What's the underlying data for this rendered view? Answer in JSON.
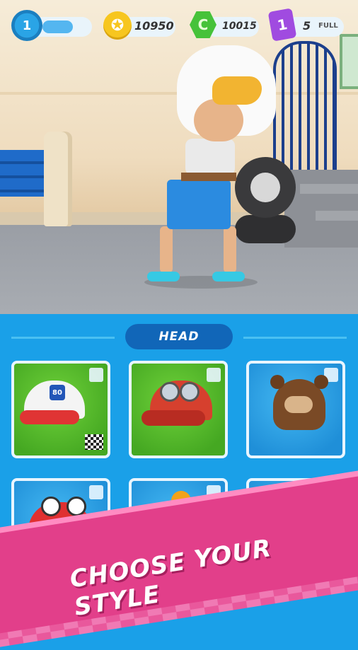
{
  "hud": {
    "level": "1",
    "coins": "10950",
    "coin_icon": "wheel-coin-icon",
    "gems": "10015",
    "gem_icon": "hexagon-gem-icon",
    "keys": "5",
    "key_icon": "key-card-icon",
    "key_card_symbol": "1",
    "key_status": "FULL",
    "xp_fill_fraction": 0.65
  },
  "wardrobe": {
    "category_tab": "HEAD",
    "items": [
      {
        "id": "cap-80",
        "bg": "green",
        "icon": "route-80-cap-icon",
        "badge": "80",
        "extra": "checkered-flag-icon"
      },
      {
        "id": "goggle-cap",
        "bg": "green",
        "icon": "goggles-cap-icon"
      },
      {
        "id": "bear-hat",
        "bg": "blue",
        "icon": "bear-hat-icon"
      },
      {
        "id": "monster-cap",
        "bg": "blue",
        "icon": "monster-cap-icon"
      },
      {
        "id": "beanie",
        "bg": "blue",
        "icon": "pompom-beanie-icon"
      },
      {
        "id": "shark-hat",
        "bg": "blue",
        "icon": "shark-hat-icon"
      }
    ]
  },
  "banner": {
    "text": "CHOOSE YOUR STYLE"
  },
  "colors": {
    "panel_bg": "#1aa0e8",
    "tab_bg": "#1166b8",
    "green_card": "#45a822",
    "blue_card": "#1f8fd8",
    "banner_pink": "#e23f8a"
  }
}
